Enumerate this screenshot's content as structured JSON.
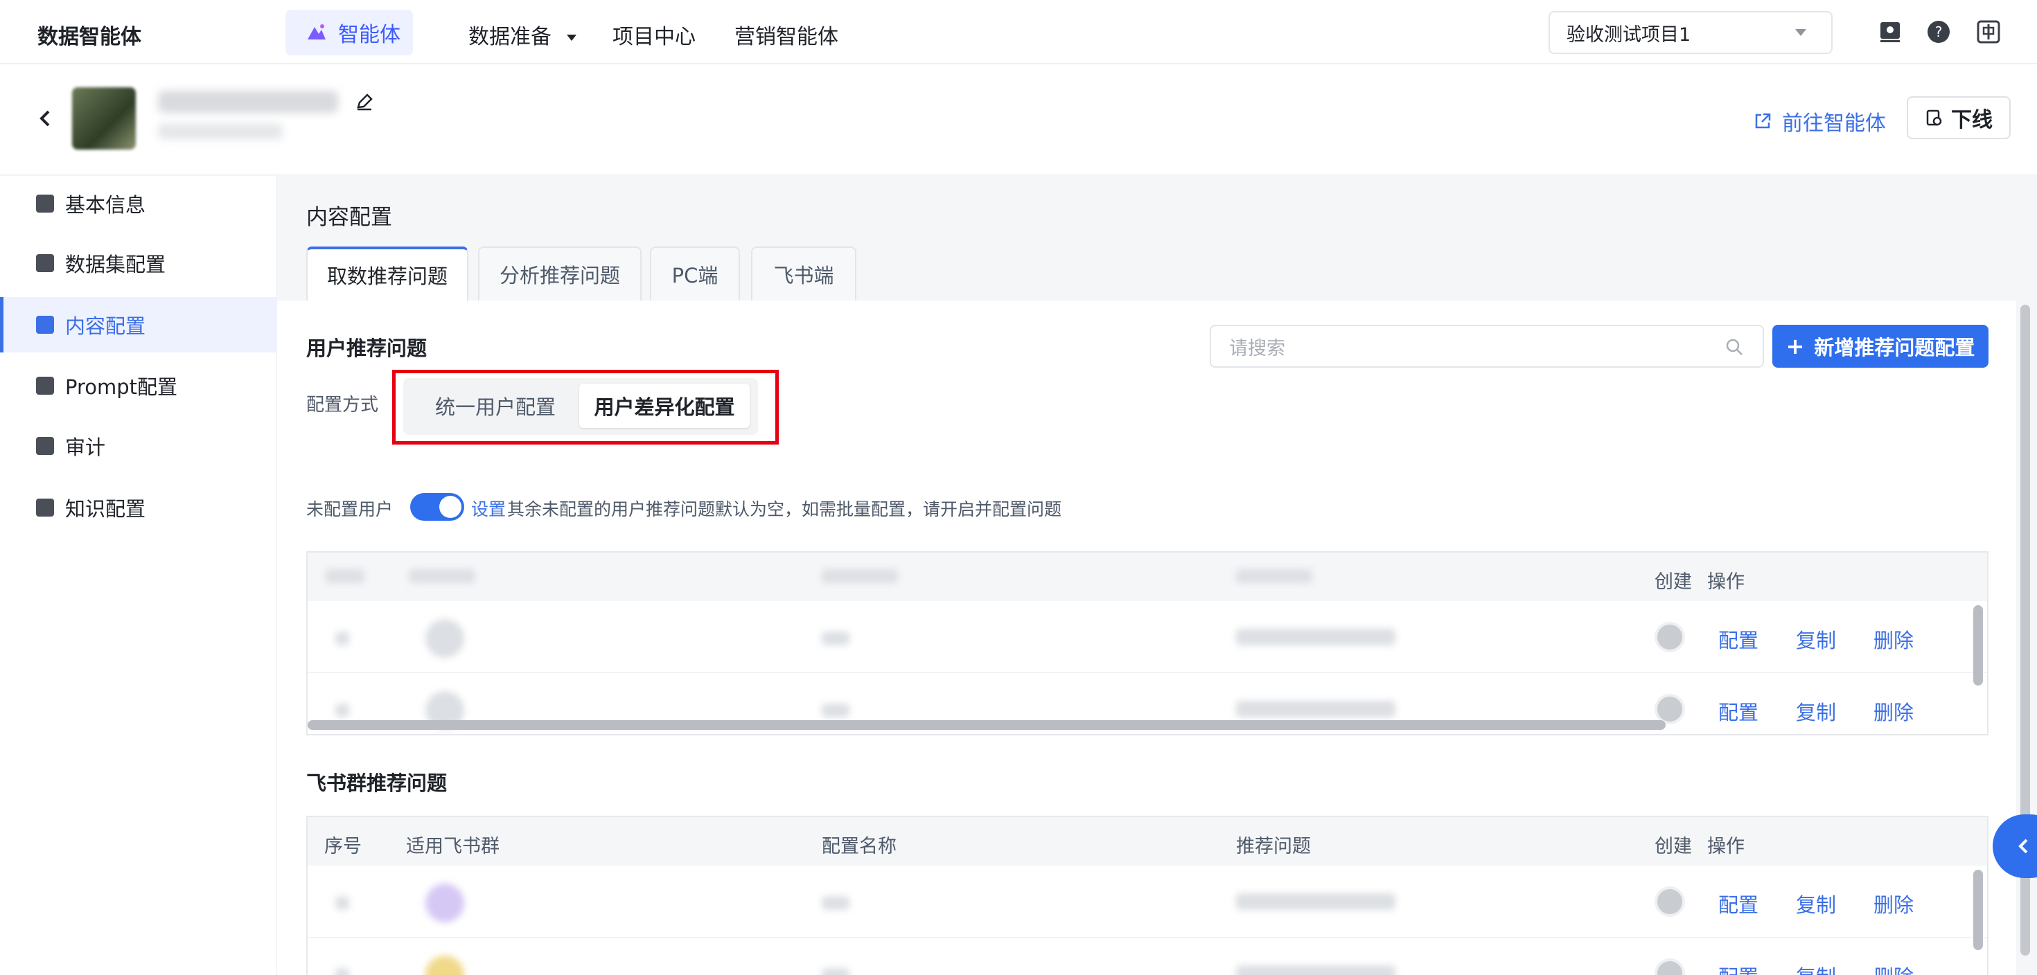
{
  "topnav": {
    "brand": "数据智能体",
    "active_nav": "智能体",
    "items": [
      "数据准备",
      "项目中心",
      "营销智能体"
    ],
    "project_select": "验收测试项目1"
  },
  "header": {
    "goto_label": "前往智能体",
    "offline_label": "下线"
  },
  "sidebar": {
    "items": [
      {
        "label": "基本信息",
        "icon": "document-icon"
      },
      {
        "label": "数据集配置",
        "icon": "layers-icon"
      },
      {
        "label": "内容配置",
        "icon": "content-config-icon",
        "active": true
      },
      {
        "label": "Prompt配置",
        "icon": "chart-icon"
      },
      {
        "label": "审计",
        "icon": "pulse-icon"
      },
      {
        "label": "知识配置",
        "icon": "bulb-icon"
      }
    ]
  },
  "main": {
    "title": "内容配置",
    "tabs": [
      "取数推荐问题",
      "分析推荐问题",
      "PC端",
      "飞书端"
    ],
    "user_section": {
      "title": "用户推荐问题",
      "search_placeholder": "请搜索",
      "add_button": "新增推荐问题配置",
      "config_mode_label": "配置方式",
      "config_options": [
        "统一用户配置",
        "用户差异化配置"
      ],
      "unconfigured_label": "未配置用户",
      "settings_link": "设置",
      "hint": "其余未配置的用户推荐问题默认为空，如需批量配置，请开启并配置问题",
      "headers": [
        "创建",
        "操作"
      ],
      "actions": [
        "配置",
        "复制",
        "删除"
      ]
    },
    "feishu_section": {
      "title": "飞书群推荐问题",
      "headers": [
        "序号",
        "适用飞书群",
        "配置名称",
        "推荐问题",
        "创建",
        "操作"
      ],
      "actions": [
        "配置",
        "复制",
        "删除"
      ]
    }
  },
  "colors": {
    "accent": "#2f6fed",
    "highlight_box": "#e50012"
  }
}
